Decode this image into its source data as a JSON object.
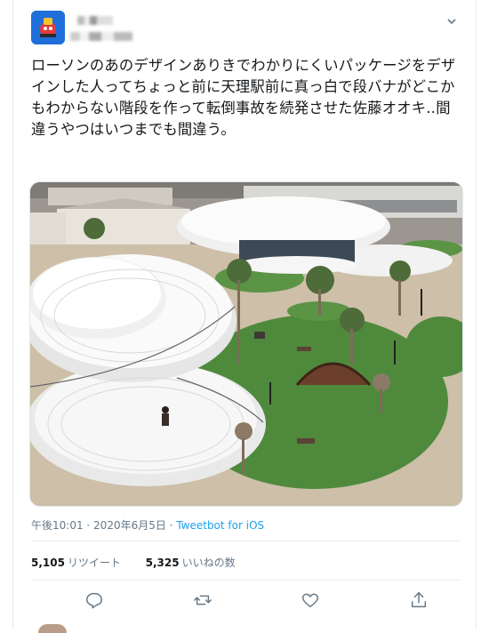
{
  "tweet": {
    "text": "ローソンのあのデザインありきでわかりにくいパッケージをデザインした人ってちょっと前に天理駅前に真っ白で段バナがどこかもわからない階段を作って転倒事故を続発させた佐藤オオキ‥間違うやつはいつまでも間違う。",
    "time": "午後10:01",
    "date": "2020年6月5日",
    "separator": " · ",
    "source": "Tweetbot for iOS",
    "retweets_count": "5,105",
    "retweets_label": "リツイート",
    "likes_count": "5,325",
    "likes_label": "いいねの数"
  },
  "icons": [
    "chevron-down-icon",
    "reply-icon",
    "retweet-icon",
    "like-icon",
    "share-icon"
  ],
  "colors": {
    "link": "#1da1f2",
    "muted": "#657786",
    "border": "#e6ecf0",
    "text": "#14171a",
    "lawn": "#4f8a3c",
    "plaza": "#cdbfa8"
  }
}
